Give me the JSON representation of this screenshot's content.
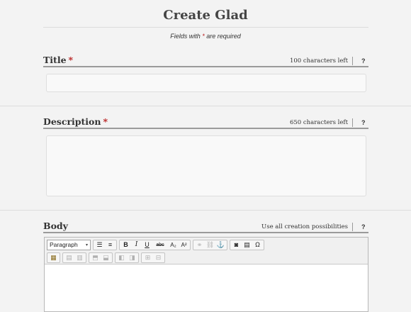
{
  "page": {
    "title": "Create Glad",
    "required_note_prefix": "Fields with",
    "required_star": "*",
    "required_note_suffix": "are required"
  },
  "fields": {
    "title": {
      "label": "Title",
      "required": "*",
      "meta": "100 characters left",
      "help": "?",
      "value": ""
    },
    "description": {
      "label": "Description",
      "required": "*",
      "meta": "650 characters left",
      "help": "?",
      "value": ""
    },
    "body": {
      "label": "Body",
      "meta": "Use all creation possibilities",
      "help": "?"
    }
  },
  "editor": {
    "format_value": "Paragraph",
    "toolbar_row1": [
      {
        "name": "format-select-arrow-icon",
        "glyph": "▾"
      },
      {
        "name": "bullet-list-icon",
        "glyph": "☰"
      },
      {
        "name": "numbered-list-icon",
        "glyph": "≡"
      },
      {
        "name": "bold-icon",
        "glyph": "B"
      },
      {
        "name": "italic-icon",
        "glyph": "I"
      },
      {
        "name": "underline-icon",
        "glyph": "U"
      },
      {
        "name": "strikethrough-icon",
        "glyph": "abc"
      },
      {
        "name": "subscript-icon",
        "glyph": "A₂"
      },
      {
        "name": "superscript-icon",
        "glyph": "A²"
      },
      {
        "name": "link-icon",
        "glyph": "⚭"
      },
      {
        "name": "unlink-icon",
        "glyph": "⛓"
      },
      {
        "name": "anchor-icon",
        "glyph": "⚓"
      },
      {
        "name": "image-icon",
        "glyph": "◙"
      },
      {
        "name": "media-icon",
        "glyph": "▤"
      },
      {
        "name": "special-char-icon",
        "glyph": "Ω"
      }
    ],
    "toolbar_row2": [
      {
        "name": "insert-table-icon",
        "glyph": "▦"
      },
      {
        "name": "table-row-icon",
        "glyph": "▤"
      },
      {
        "name": "table-cell-icon",
        "glyph": "▥"
      },
      {
        "name": "insert-row-before-icon",
        "glyph": "⬒"
      },
      {
        "name": "insert-row-after-icon",
        "glyph": "⬓"
      },
      {
        "name": "insert-col-before-icon",
        "glyph": "◧"
      },
      {
        "name": "insert-col-after-icon",
        "glyph": "◨"
      },
      {
        "name": "split-cells-icon",
        "glyph": "⊞"
      },
      {
        "name": "merge-cells-icon",
        "glyph": "⊟"
      }
    ]
  }
}
